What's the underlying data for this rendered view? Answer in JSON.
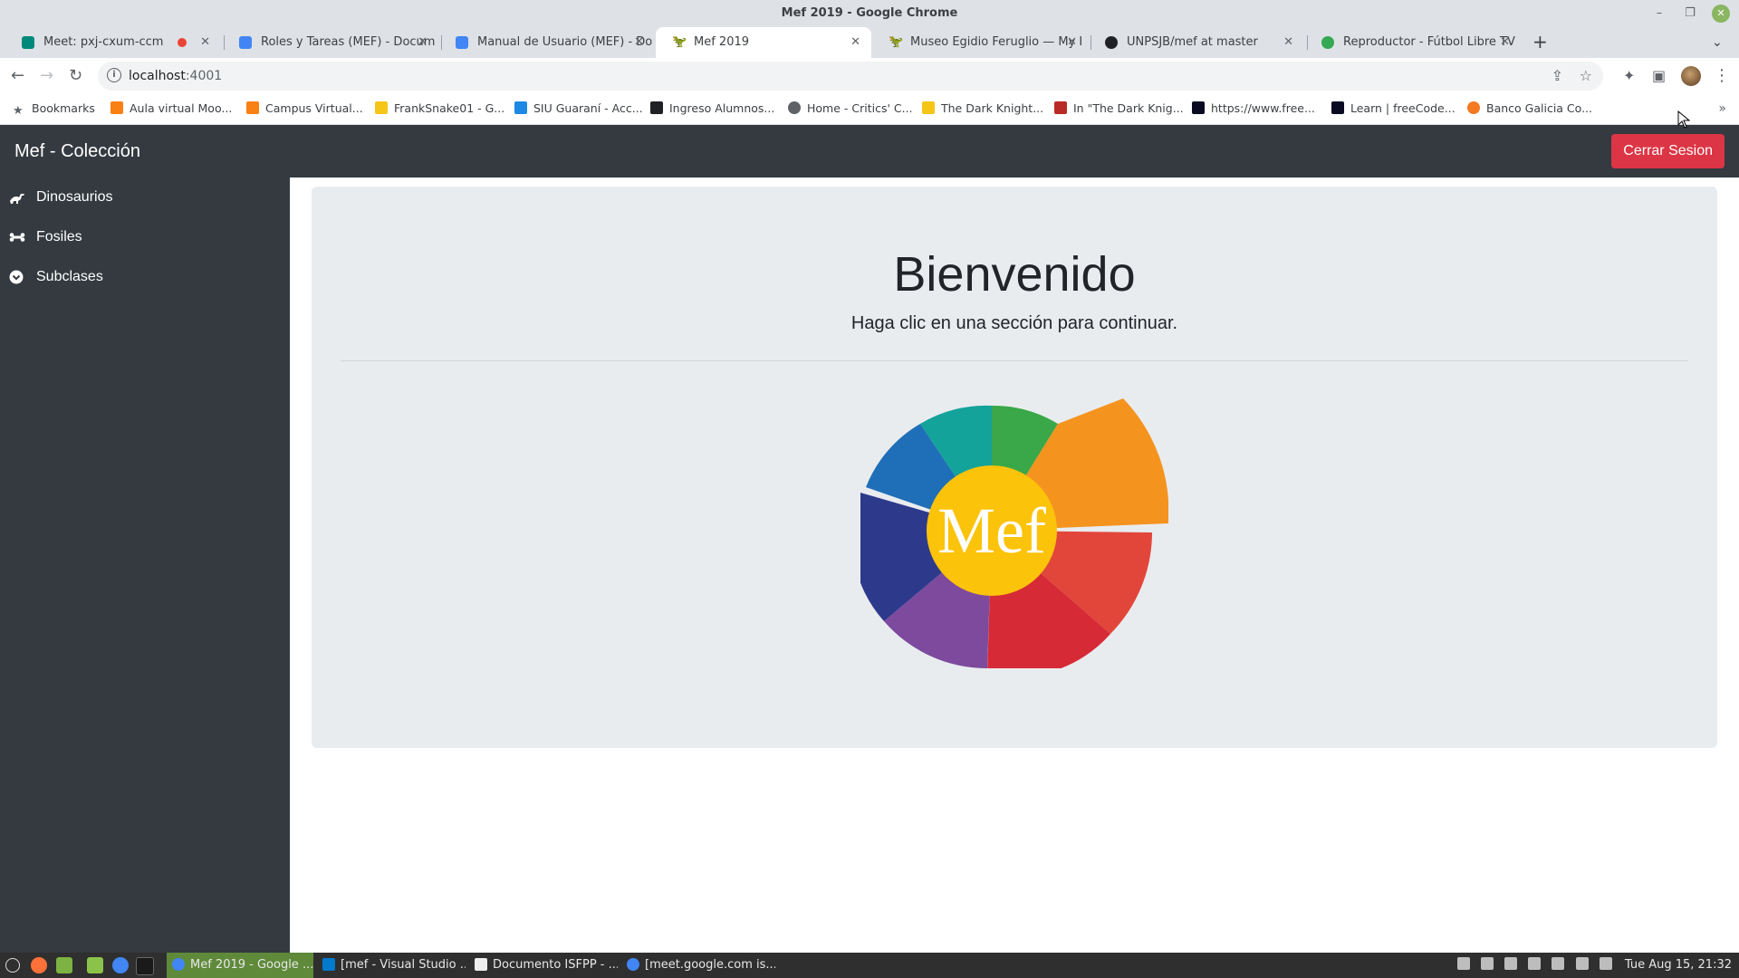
{
  "window": {
    "title": "Mef 2019 - Google Chrome"
  },
  "tabs": [
    {
      "label": "Meet: pxj-cxum-ccm",
      "favicon_color": "#00897b",
      "recording": true,
      "active": false
    },
    {
      "label": "Roles y Tareas (MEF) - Docum",
      "favicon_color": "#4285f4",
      "active": false
    },
    {
      "label": "Manual de Usuario (MEF) - Do",
      "favicon_color": "#4285f4",
      "active": false
    },
    {
      "label": "Mef 2019",
      "favicon_color": "#202124",
      "active": true
    },
    {
      "label": "Museo Egidio Feruglio — My I",
      "favicon_color": "#202124",
      "active": false
    },
    {
      "label": "UNPSJB/mef at master",
      "favicon_color": "#202124",
      "active": false
    },
    {
      "label": "Reproductor - Fútbol Libre TV",
      "favicon_color": "#34a853",
      "active": false
    }
  ],
  "toolbar": {
    "url_host": "localhost",
    "url_port": ":4001"
  },
  "bookmarks": {
    "items": [
      {
        "label": "Bookmarks",
        "icon": "star-icon",
        "color": "#5f6368"
      },
      {
        "label": "Aula virtual Moo...",
        "icon": "moodle-icon",
        "color": "#f98012"
      },
      {
        "label": "Campus Virtual...",
        "icon": "moodle-icon",
        "color": "#f98012"
      },
      {
        "label": "FrankSnake01 - G...",
        "icon": "r-icon",
        "color": "#f5c518"
      },
      {
        "label": "SIU Guaraní - Acc...",
        "icon": "siu-icon",
        "color": "#1e88e5"
      },
      {
        "label": "Ingreso Alumnos...",
        "icon": "mask-icon",
        "color": "#202124"
      },
      {
        "label": "Home - Critics' C...",
        "icon": "globe-icon",
        "color": "#5f6368"
      },
      {
        "label": "The Dark Knight...",
        "icon": "imdb-icon",
        "color": "#f5c518"
      },
      {
        "label": "In \"The Dark Knig...",
        "icon": "quora-icon",
        "color": "#b92b27"
      },
      {
        "label": "https://www.free...",
        "icon": "freecodecamp-icon",
        "color": "#0a0a23"
      },
      {
        "label": "Learn | freeCode...",
        "icon": "freecodecamp-icon",
        "color": "#0a0a23"
      },
      {
        "label": "Banco Galicia Co...",
        "icon": "galicia-icon",
        "color": "#f47920"
      }
    ]
  },
  "app": {
    "brand": "Mef - Colección",
    "logout_label": "Cerrar Sesion",
    "accent_danger": "#dc3545",
    "sidebar": [
      {
        "label": "Dinosaurios",
        "icon": "dinosaur-icon"
      },
      {
        "label": "Fosiles",
        "icon": "bone-icon"
      },
      {
        "label": "Subclases",
        "icon": "chevron-circle-icon"
      }
    ],
    "welcome_title": "Bienvenido",
    "welcome_lead": "Haga clic en una sección para continuar.",
    "logo_text": "Mef"
  },
  "taskbar": {
    "windows": [
      {
        "label": "Mef 2019 - Google ...",
        "active": true,
        "icon_color": "#4285f4"
      },
      {
        "label": "[mef - Visual Studio ...",
        "active": false,
        "icon_color": "#007acc"
      },
      {
        "label": "Documento ISFPP - ...",
        "active": false,
        "icon_color": "#eeeeee"
      },
      {
        "label": "[meet.google.com is...",
        "active": false,
        "icon_color": "#4285f4"
      }
    ],
    "clock": "Tue Aug 15, 21:32"
  }
}
